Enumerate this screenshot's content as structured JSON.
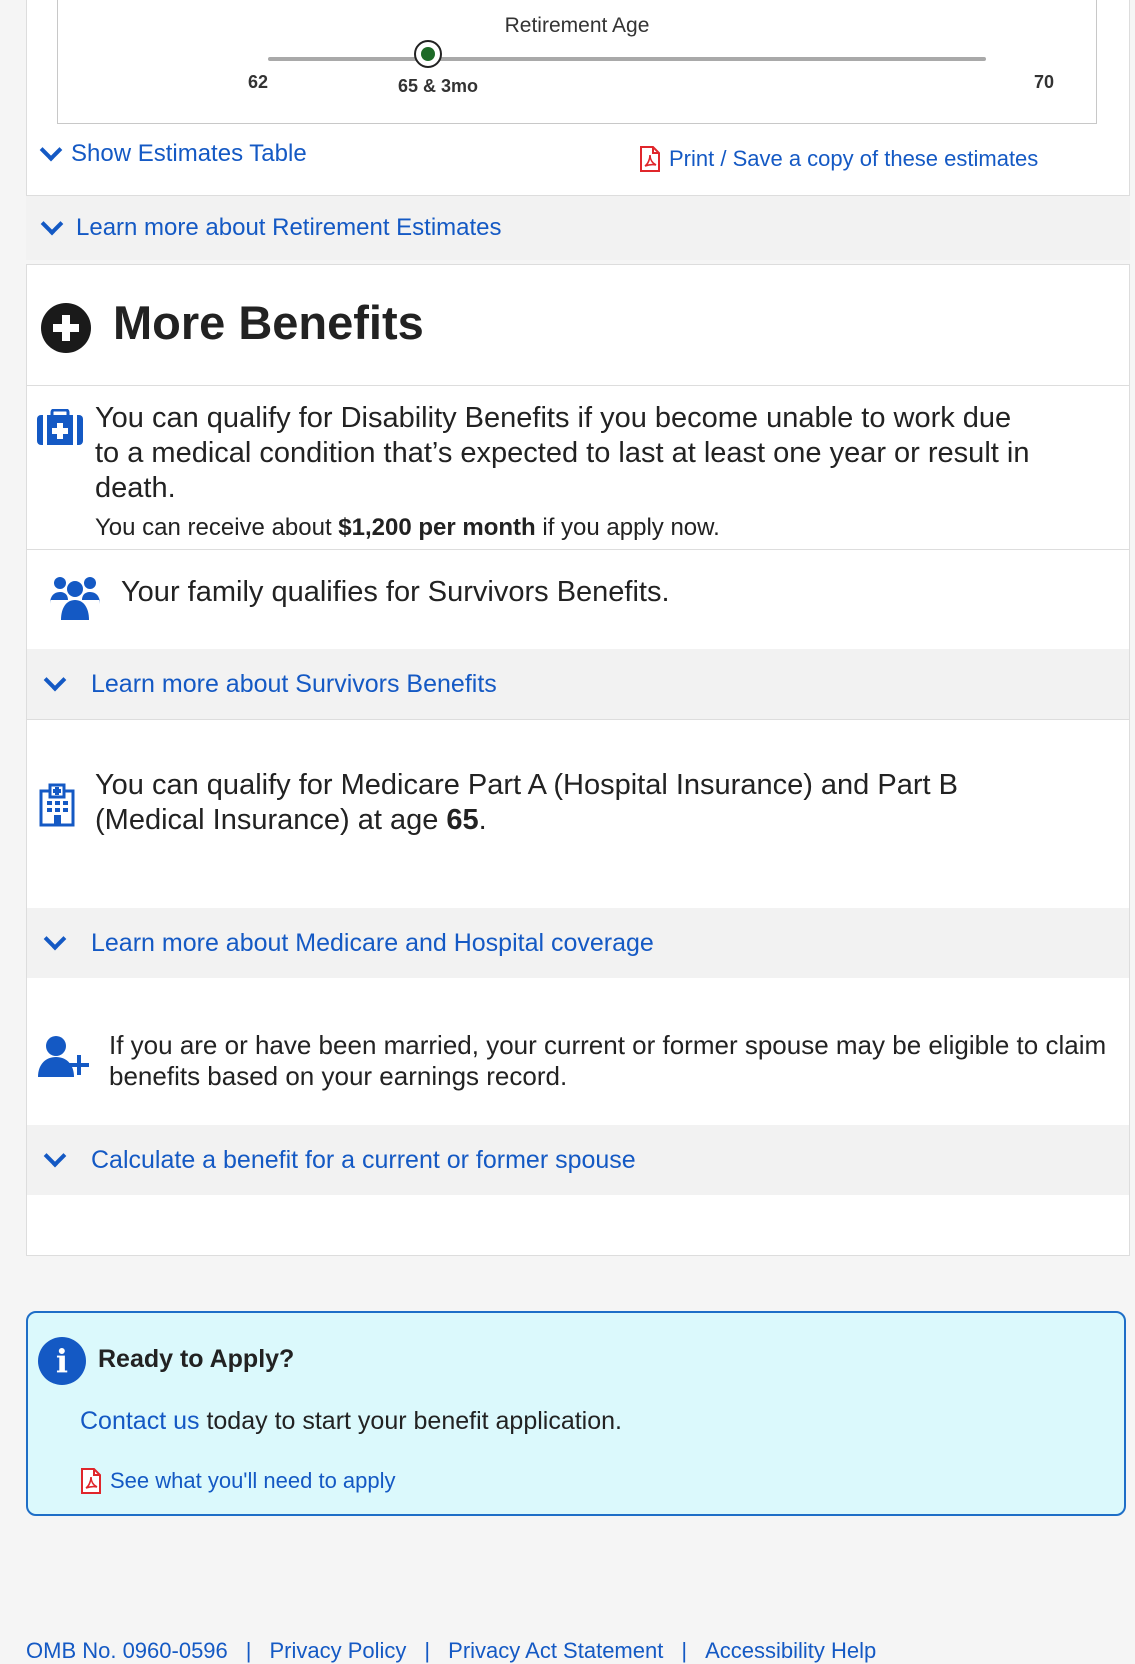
{
  "slider": {
    "title": "Retirement Age",
    "min_label": "62",
    "max_label": "70",
    "current_label": "65 & 3mo"
  },
  "estimates": {
    "show_table": "Show Estimates Table",
    "print_save": "Print / Save a copy of these estimates",
    "learn_more": "Learn more about Retirement Estimates"
  },
  "more_benefits": {
    "title": "More Benefits",
    "disability": {
      "text": "You can qualify for Disability Benefits if you become unable to work due to a medical condition that’s expected to last at least one year or result in death.",
      "sub_prefix": "You can receive about ",
      "sub_amount": "$1,200 per month",
      "sub_suffix": " if you apply now."
    },
    "survivors": {
      "text": "Your family qualifies for Survivors Benefits.",
      "learn_more": "Learn more about Survivors Benefits"
    },
    "medicare": {
      "text_prefix": "You can qualify for Medicare Part A (Hospital Insurance) and Part B (Medical Insurance) at age ",
      "age": "65",
      "text_suffix": ".",
      "learn_more": "Learn more about Medicare and Hospital coverage"
    },
    "spouse": {
      "text": "If you are or have been married, your current or former spouse may be eligible to claim benefits based on your earnings record.",
      "calculate": "Calculate a benefit for a current or former spouse"
    }
  },
  "apply": {
    "title": "Ready to Apply?",
    "contact_link": "Contact us",
    "body_suffix": " today to start your benefit application.",
    "need_link": "See what you'll need to apply"
  },
  "footer": {
    "omb": "OMB No. 0960-0596",
    "privacy": "Privacy Policy",
    "privacy_act": "Privacy Act Statement",
    "accessibility": "Accessibility Help",
    "separator": "|"
  },
  "colors": {
    "link": "#1459c4",
    "slider_thumb": "#1d6a27",
    "apply_bg": "#dbf9fc",
    "pdf_icon": "#e0262b"
  }
}
